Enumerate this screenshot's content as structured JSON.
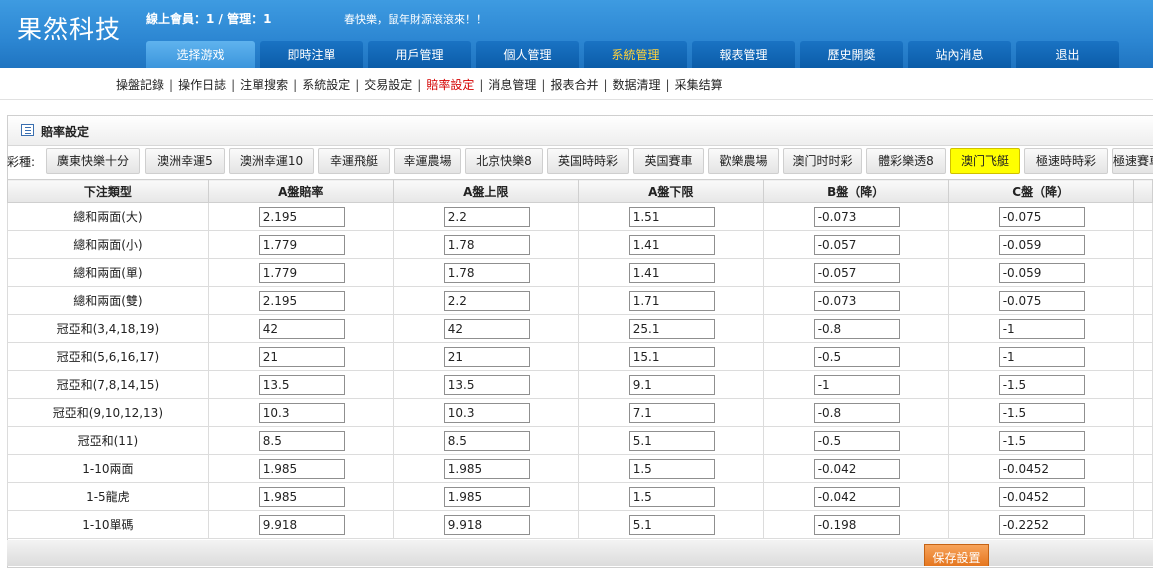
{
  "header": {
    "brand": "果然科技",
    "online": "線上會員：1 / 管理：1",
    "greeting": "春快樂，鼠年財源滾滾來！！"
  },
  "nav": {
    "tabs": [
      "选择游戏",
      "即時注單",
      "用戶管理",
      "個人管理",
      "系統管理",
      "報表管理",
      "歷史開獎",
      "站內消息",
      "退出"
    ]
  },
  "subnav": {
    "items": [
      "操盤記錄",
      "操作日誌",
      "注單搜索",
      "系統設定",
      "交易設定",
      "賠率設定",
      "消息管理",
      "报表合并",
      "数据清理",
      "采集结算"
    ]
  },
  "panel": {
    "title": "賠率設定"
  },
  "lottery": {
    "label": "彩種:",
    "items": [
      "廣東快樂十分",
      "澳洲幸運5",
      "澳洲幸運10",
      "幸運飛艇",
      "幸運農場",
      "北京快樂8",
      "英国時時彩",
      "英国賽車",
      "歡樂農場",
      "澳门时时彩",
      "體彩樂透8",
      "澳门飞艇",
      "極速時時彩",
      "極速賽車"
    ],
    "active": "澳门飞艇"
  },
  "table": {
    "headers": [
      "下注類型",
      "A盤賠率",
      "A盤上限",
      "A盤下限",
      "B盤（降）",
      "C盤（降）"
    ],
    "rows": [
      [
        "總和兩面(大)",
        "2.195",
        "2.2",
        "1.51",
        "-0.073",
        "-0.075"
      ],
      [
        "總和兩面(小)",
        "1.779",
        "1.78",
        "1.41",
        "-0.057",
        "-0.059"
      ],
      [
        "總和兩面(單)",
        "1.779",
        "1.78",
        "1.41",
        "-0.057",
        "-0.059"
      ],
      [
        "總和兩面(雙)",
        "2.195",
        "2.2",
        "1.71",
        "-0.073",
        "-0.075"
      ],
      [
        "冠亞和(3,4,18,19)",
        "42",
        "42",
        "25.1",
        "-0.8",
        "-1"
      ],
      [
        "冠亞和(5,6,16,17)",
        "21",
        "21",
        "15.1",
        "-0.5",
        "-1"
      ],
      [
        "冠亞和(7,8,14,15)",
        "13.5",
        "13.5",
        "9.1",
        "-1",
        "-1.5"
      ],
      [
        "冠亞和(9,10,12,13)",
        "10.3",
        "10.3",
        "7.1",
        "-0.8",
        "-1.5"
      ],
      [
        "冠亞和(11)",
        "8.5",
        "8.5",
        "5.1",
        "-0.5",
        "-1.5"
      ],
      [
        "1-10兩面",
        "1.985",
        "1.985",
        "1.5",
        "-0.042",
        "-0.0452"
      ],
      [
        "1-5龍虎",
        "1.985",
        "1.985",
        "1.5",
        "-0.042",
        "-0.0452"
      ],
      [
        "1-10單碼",
        "9.918",
        "9.918",
        "5.1",
        "-0.198",
        "-0.2252"
      ]
    ]
  },
  "footer": {
    "save_label": "保存設置"
  },
  "colors": {
    "header_blue": "#2c86d2",
    "nav_tab": "#0b5ca8",
    "active_tab_text": "#ffd23a",
    "active_subnav": "#d40000",
    "active_lottery": "#ffff00",
    "save_button": "#e5761f"
  }
}
